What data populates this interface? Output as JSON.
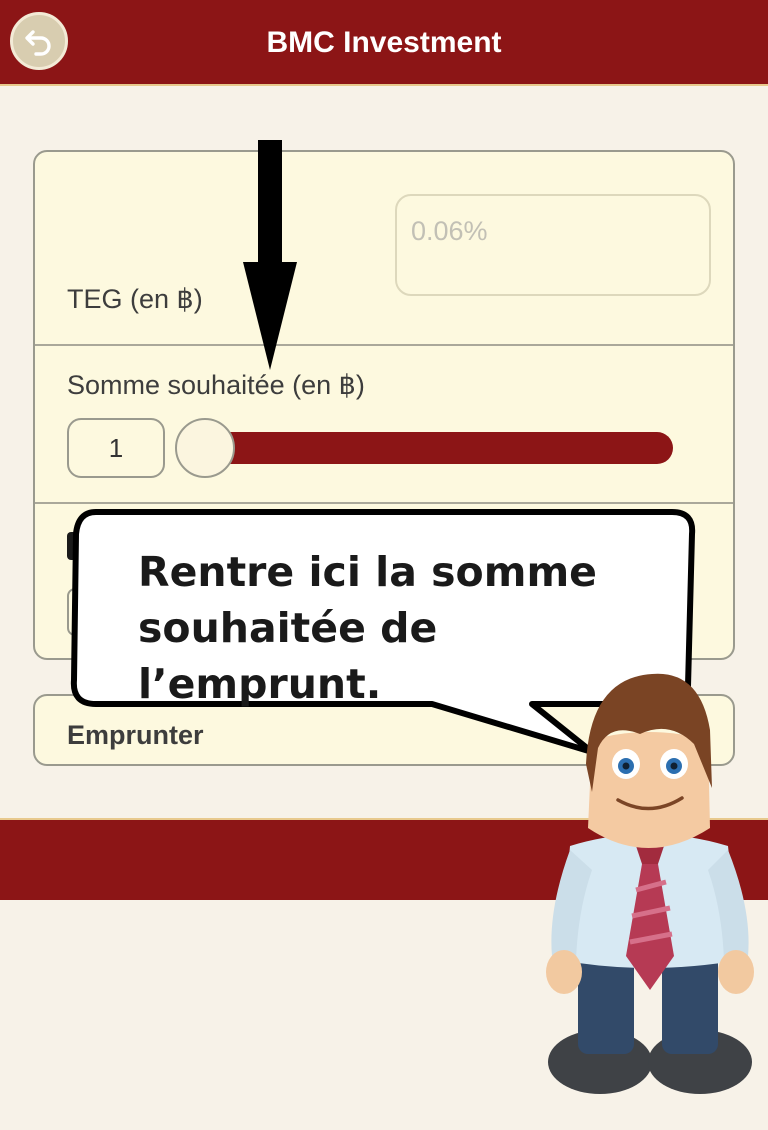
{
  "header": {
    "title": "BMC Investment"
  },
  "form": {
    "teg": {
      "label": "TEG (en ฿)",
      "value": "0.06%"
    },
    "somme": {
      "label": "Somme souhaitée (en ฿)",
      "value": "1",
      "slider_level": 0
    }
  },
  "actions": {
    "emprunter_label": "Emprunter"
  },
  "tutorial": {
    "bubble_text": "Rentre ici la somme souhaitée de l’emprunt."
  },
  "colors": {
    "brand": "#8c1516",
    "card_bg": "#fdf9df",
    "page_bg": "#f7f2e8"
  },
  "icons": {
    "back": "back-arrow-icon",
    "pointer": "down-arrow-icon",
    "mascot": "mascot-character"
  }
}
